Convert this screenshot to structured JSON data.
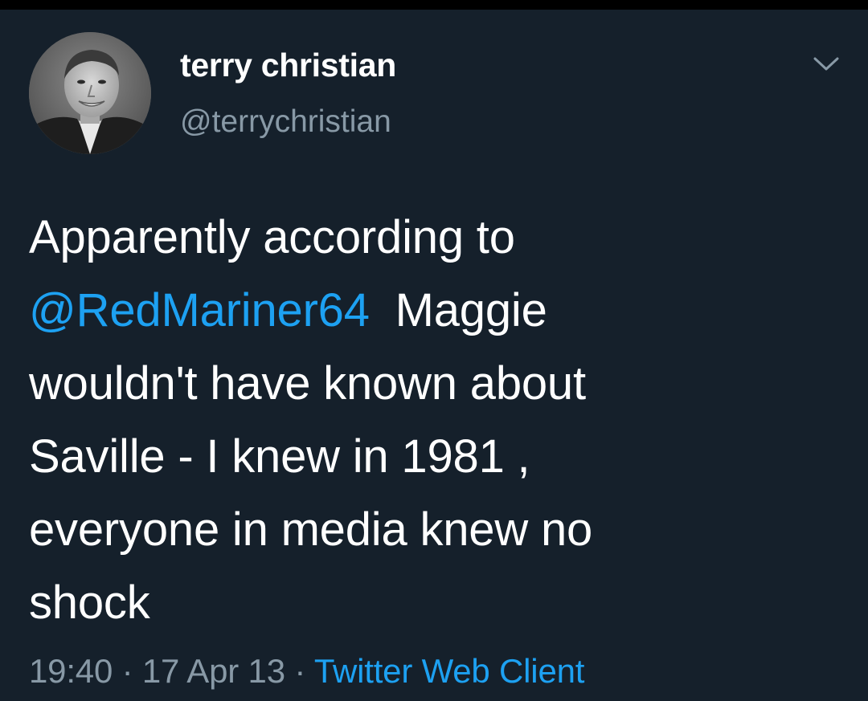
{
  "tweet": {
    "author_name": "terry christian",
    "author_handle": "@terrychristian",
    "text_line1": "Apparently according to",
    "mention": "@RedMariner64",
    "text_line2_rest": "  Maggie",
    "text_line3": "wouldn't have known about",
    "text_line4": "Saville - I knew in 1981 ,",
    "text_line5": "everyone in media knew no",
    "text_line6": "shock",
    "time": "19:40",
    "separator": " · ",
    "date": "17 Apr 13",
    "separator2": " · ",
    "source": "Twitter Web Client"
  },
  "icons": {
    "avatar": "profile-photo",
    "menu": "chevron-down-icon"
  },
  "colors": {
    "background": "#15202b",
    "text": "#ffffff",
    "secondary": "#8899a6",
    "link": "#1da1f2"
  }
}
